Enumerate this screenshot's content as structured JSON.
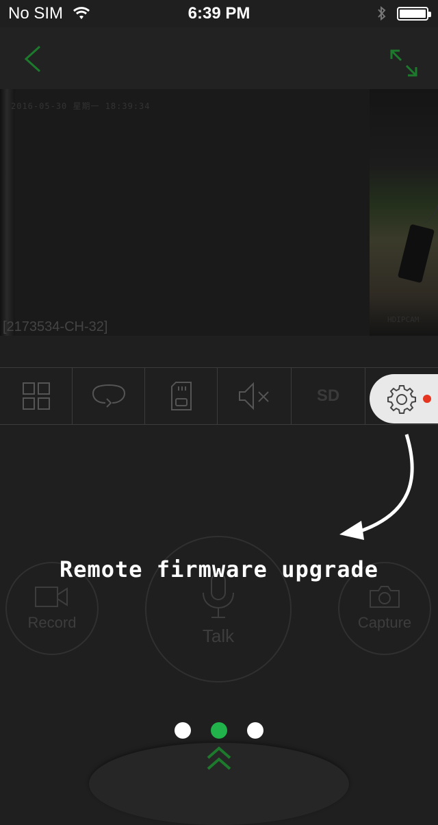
{
  "status_bar": {
    "carrier": "No SIM",
    "time": "6:39 PM",
    "wifi_icon": "wifi-icon",
    "bluetooth_icon": "bluetooth-icon",
    "battery_icon": "battery-icon"
  },
  "nav": {
    "back_icon": "chevron-left-icon",
    "expand_icon": "expand-icon",
    "accent_color": "#1d7a2c"
  },
  "video": {
    "timestamp": "2016-05-30  星期一  18:39:34",
    "camera_id": "[2173534-CH-32]",
    "watermark": "HDIPCAM"
  },
  "toolbar": {
    "items": [
      {
        "name": "grid-icon"
      },
      {
        "name": "rotate-icon"
      },
      {
        "name": "sd-card-icon"
      },
      {
        "name": "mute-icon"
      },
      {
        "label": "SD"
      },
      {
        "name": "gear-icon",
        "badge_color": "#e53520"
      }
    ]
  },
  "controls": {
    "record_label": "Record",
    "talk_label": "Talk",
    "capture_label": "Capture"
  },
  "tip": {
    "text": "Remote firmware upgrade"
  },
  "pager": {
    "current_page": 2,
    "total_pages": 3,
    "active_color": "#22b24c"
  }
}
